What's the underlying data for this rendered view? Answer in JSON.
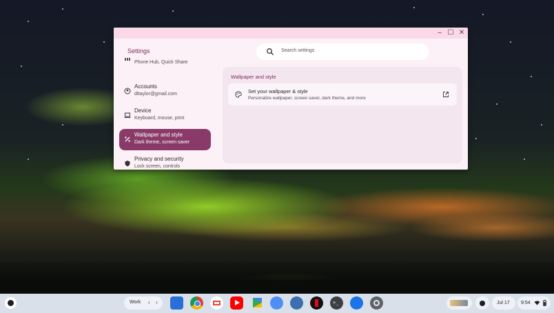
{
  "window": {
    "app_title": "Settings",
    "controls": {
      "minimize": "–",
      "maximize": "☐",
      "close": "✕"
    },
    "search": {
      "placeholder": "Search settings"
    }
  },
  "sidebar": {
    "items": [
      {
        "title": "",
        "subtitle": "Phone Hub, Quick Share",
        "icon": "phone-hub-icon"
      },
      {
        "title": "Accounts",
        "subtitle": "dttaylor@gmail.com",
        "icon": "account-icon"
      },
      {
        "title": "Device",
        "subtitle": "Keyboard, mouse, print",
        "icon": "laptop-icon"
      },
      {
        "title": "Wallpaper and style",
        "subtitle": "Dark theme, screen saver",
        "icon": "brush-icon",
        "active": true
      },
      {
        "title": "Privacy and security",
        "subtitle": "Lock screen, controls",
        "icon": "shield-icon"
      }
    ]
  },
  "main": {
    "section_title": "Wallpaper and style",
    "row": {
      "title": "Set your wallpaper & style",
      "subtitle": "Personalize wallpaper, screen saver, dark theme, and more",
      "icon": "palette-icon",
      "action_icon": "open-external-icon"
    }
  },
  "shelf": {
    "desk_label": "Work",
    "apps": [
      "files",
      "chrome",
      "gmail",
      "youtube",
      "play-store",
      "tips",
      "photos",
      "netflix",
      "terminal",
      "messages",
      "settings"
    ],
    "date": "Jul 17",
    "time": "9:54"
  },
  "colors": {
    "accent": "#8a3a68",
    "titlebar": "#fbd9e8",
    "window_bg": "#fbf1f6",
    "shelf_bg": "#d9e0e9"
  }
}
